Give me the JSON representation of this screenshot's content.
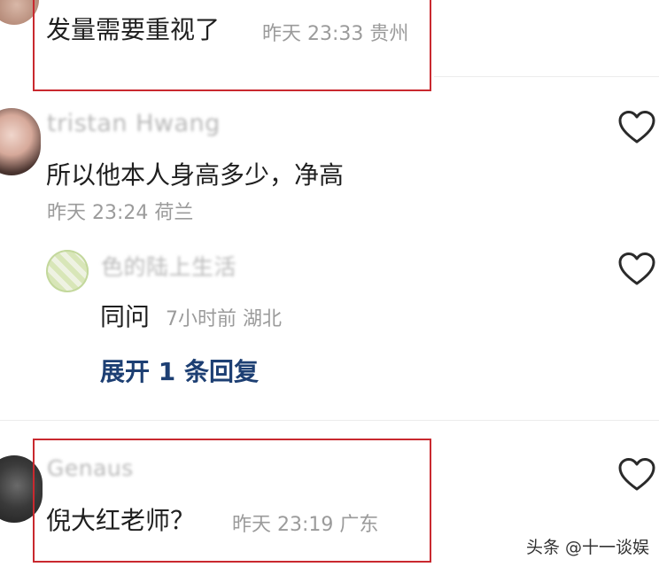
{
  "comments": [
    {
      "text": "发量需要重视了",
      "meta": "昨天 23:33 贵州"
    },
    {
      "username": "tristan Hwang",
      "text": "所以他本人身高多少，净高",
      "meta": "昨天 23:24 荷兰",
      "reply": {
        "username": "色的陆上生活",
        "text": "同问",
        "meta": "7小时前 湖北"
      },
      "expand_label": "展开 1 条回复"
    },
    {
      "username": "Genaus",
      "text": "倪大红老师？",
      "meta": "昨天 23:19 广东"
    }
  ],
  "watermark": "头条 @十一谈娱",
  "colors": {
    "highlight_border": "#c9292f",
    "expand_link": "#1d3f73",
    "meta_text": "#9b9b9b"
  }
}
